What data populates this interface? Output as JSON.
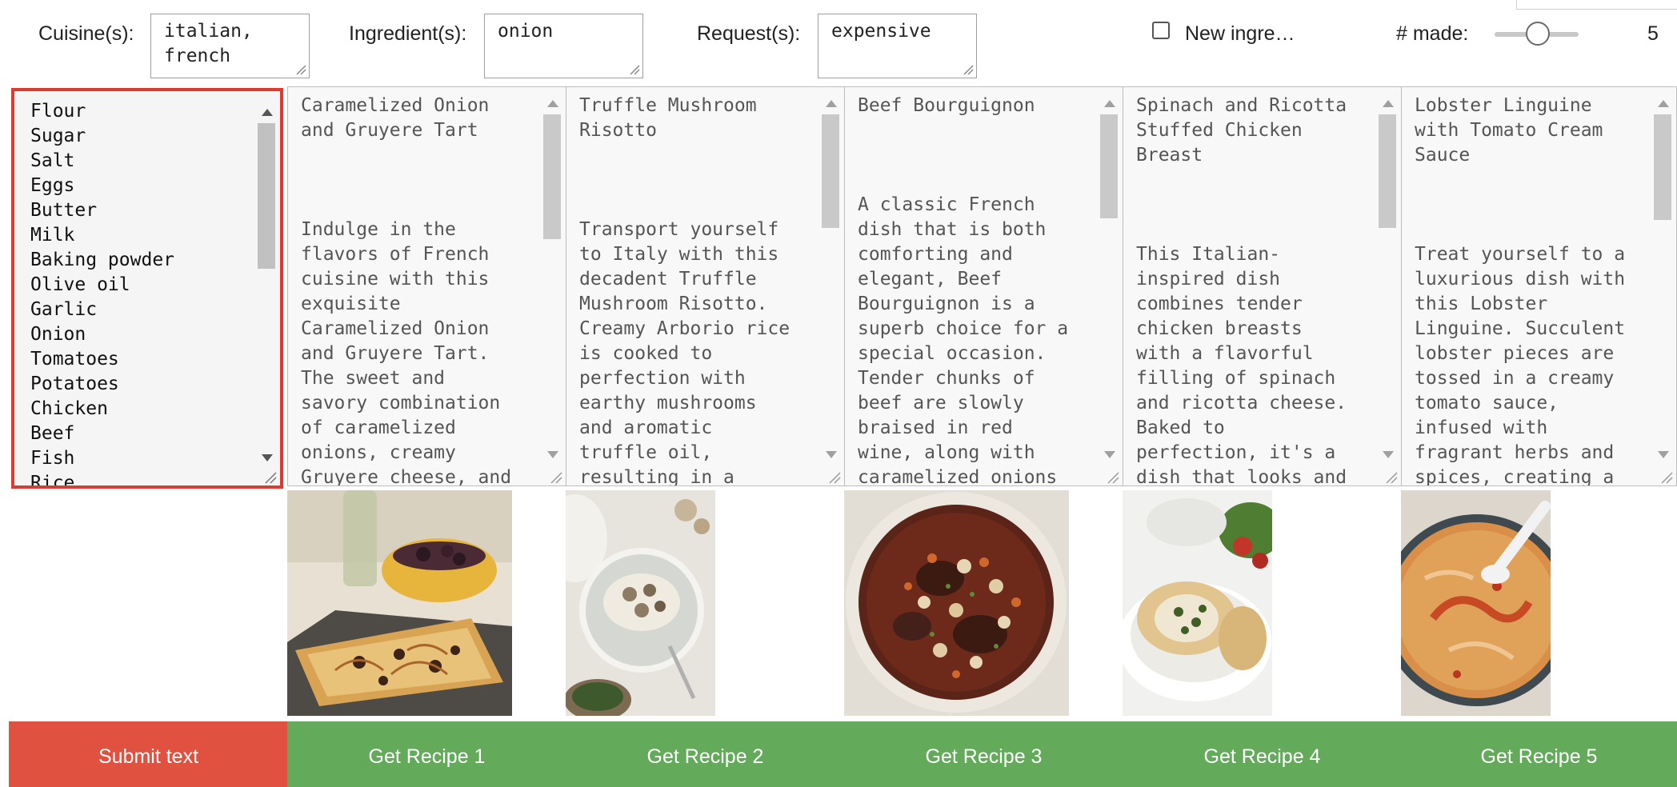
{
  "controls": {
    "cuisine_label": "Cuisine(s):",
    "cuisine_value": "italian,\nfrench",
    "ingredient_label": "Ingredient(s):",
    "ingredient_value": "onion",
    "request_label": "Request(s):",
    "request_value": "expensive",
    "new_ingredient_label": "New ingre…",
    "new_ingredient_checked": false,
    "made_label": "# made:",
    "made_value": "5",
    "made_slider_fraction": 0.5
  },
  "ingredients": [
    "Flour",
    "Sugar",
    "Salt",
    "Eggs",
    "Butter",
    "Milk",
    "Baking powder",
    "Olive oil",
    "Garlic",
    "Onion",
    "Tomatoes",
    "Potatoes",
    "Chicken",
    "Beef",
    "Fish",
    "Rice"
  ],
  "recipes": [
    {
      "text": "Caramelized Onion\nand Gruyere Tart\n\n\n\nIndulge in the\nflavors of French\ncuisine with this\nexquisite\nCaramelized Onion\nand Gruyere Tart.\nThe sweet and\nsavory combination\nof caramelized\nonions, creamy\nGruyere cheese, and",
      "button": "Get Recipe 1"
    },
    {
      "text": "Truffle Mushroom\nRisotto\n\n\n\nTransport yourself\nto Italy with this\ndecadent Truffle\nMushroom Risotto.\nCreamy Arborio rice\nis cooked to\nperfection with\nearthy mushrooms\nand aromatic\ntruffle oil,\nresulting in a",
      "button": "Get Recipe 2"
    },
    {
      "text": "Beef Bourguignon\n\n\n\nA classic French\ndish that is both\ncomforting and\nelegant, Beef\nBourguignon is a\nsuperb choice for a\nspecial occasion.\nTender chunks of\nbeef are slowly\nbraised in red\nwine, along with\ncaramelized onions",
      "button": "Get Recipe 3"
    },
    {
      "text": "Spinach and Ricotta\nStuffed Chicken\nBreast\n\n\n\nThis Italian-\ninspired dish\ncombines tender\nchicken breasts\nwith a flavorful\nfilling of spinach\nand ricotta cheese.\nBaked to\nperfection, it's a\ndish that looks and",
      "button": "Get Recipe 4"
    },
    {
      "text": "Lobster Linguine\nwith Tomato Cream\nSauce\n\n\n\nTreat yourself to a\nluxurious dish with\nthis Lobster\nLinguine. Succulent\nlobster pieces are\ntossed in a creamy\ntomato sauce,\ninfused with\nfragrant herbs and\nspices, creating a",
      "button": "Get Recipe 5"
    }
  ],
  "submit_button": "Submit text",
  "colors": {
    "submit": "#e0513f",
    "recipe_button": "#63ab5b",
    "ingredient_border": "#e03a2f"
  }
}
